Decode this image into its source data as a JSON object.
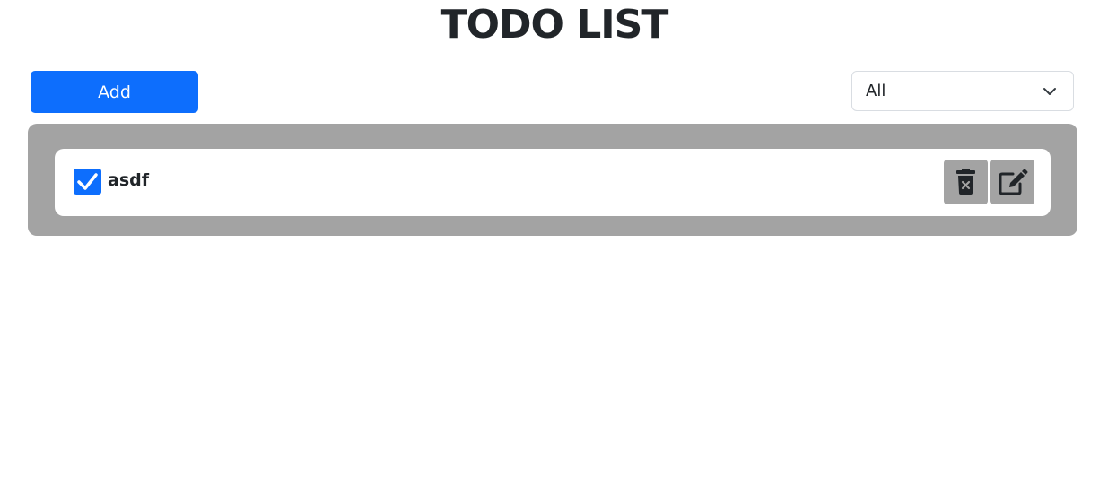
{
  "page": {
    "title": "TODO LIST"
  },
  "toolbar": {
    "add_label": "Add",
    "filter": {
      "selected": "All"
    }
  },
  "todos": [
    {
      "text": "asdf",
      "completed": true
    }
  ],
  "icons": {
    "checkbox": "checkmark-icon",
    "delete": "trash-icon",
    "edit": "edit-icon",
    "dropdown": "chevron-down-icon"
  },
  "colors": {
    "primary": "#0d6efd",
    "panel": "#a3a3a3",
    "text": "#212529"
  }
}
